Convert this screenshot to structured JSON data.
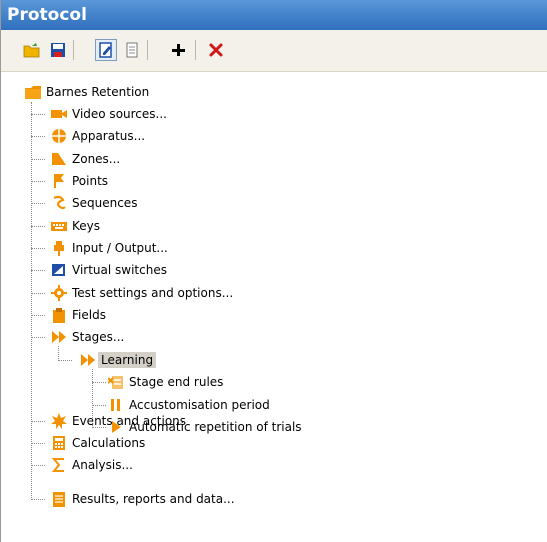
{
  "panel": {
    "title": "Protocol"
  },
  "toolbar": {
    "buttons": [
      {
        "name": "open-folder-icon"
      },
      {
        "name": "save-icon"
      },
      {
        "name": "edit-icon"
      },
      {
        "name": "document-icon"
      },
      {
        "name": "add-icon"
      },
      {
        "name": "delete-icon"
      }
    ]
  },
  "tree": {
    "root": "Barnes Retention",
    "items": [
      "Video sources...",
      "Apparatus...",
      "Zones...",
      "Points",
      "Sequences",
      "Keys",
      "Input / Output...",
      "Virtual switches",
      "Test settings and options...",
      "Fields",
      "Stages..."
    ],
    "stage": "Learning",
    "stage_children": [
      "Stage end rules",
      "Accustomisation period",
      "Automatic repetition of trials"
    ],
    "after": [
      "Events and actions",
      "Calculations",
      "Analysis...",
      "Results, reports and data..."
    ]
  },
  "colors": {
    "title_gradient_top": "#5a97d8",
    "title_gradient_bottom": "#2f6fbe",
    "toolbar_bg": "#f3f1ea",
    "selection_bg": "#d4d0c8",
    "icon_orange": "#f39200"
  }
}
